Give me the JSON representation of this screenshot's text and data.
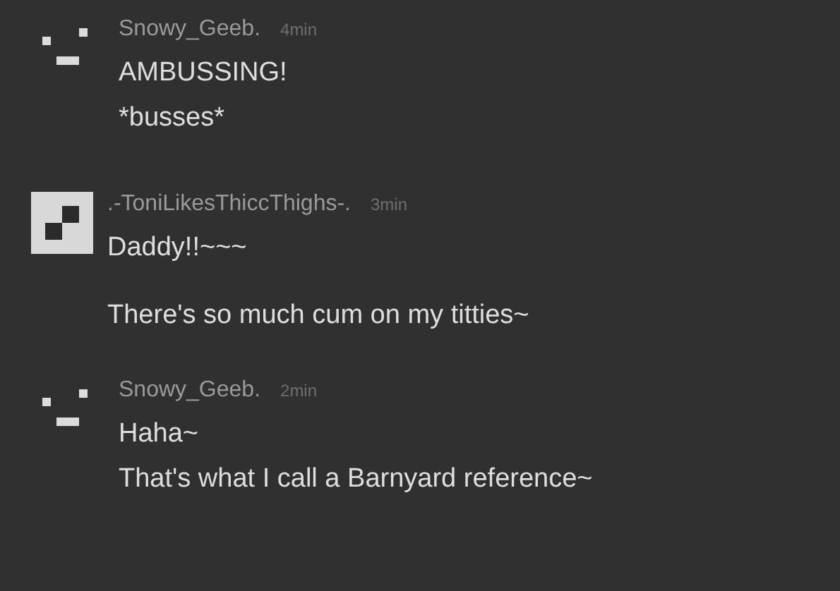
{
  "posts": [
    {
      "avatar": {
        "kind": "face"
      },
      "author": "Snowy_Geeb.",
      "time": "4min",
      "paragraphs": [
        [
          "AMBUSSING!",
          "*busses*"
        ]
      ]
    },
    {
      "avatar": {
        "kind": "square"
      },
      "author": ".-ToniLikesThiccThighs-.",
      "time": "3min",
      "paragraphs": [
        [
          "Daddy!!~~~"
        ],
        [
          "There's so much cum on my titties~"
        ]
      ]
    },
    {
      "avatar": {
        "kind": "face"
      },
      "author": "Snowy_Geeb.",
      "time": "2min",
      "paragraphs": [
        [
          "Haha~",
          "That's what I call a Barnyard reference~"
        ]
      ]
    }
  ]
}
